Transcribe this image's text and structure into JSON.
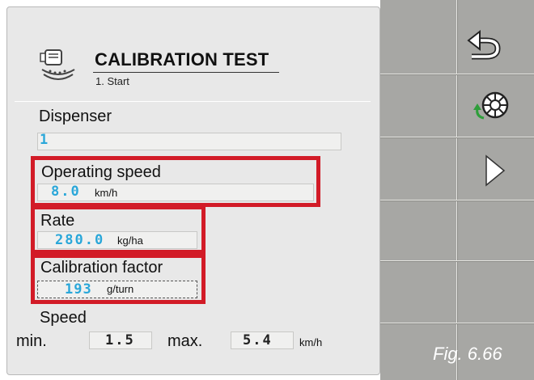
{
  "header": {
    "title": "CALIBRATION TEST",
    "subtitle": "1. Start"
  },
  "dispenser": {
    "label": "Dispenser",
    "value": "1"
  },
  "operating_speed": {
    "label": "Operating speed",
    "value": "8.0",
    "unit": "km/h"
  },
  "rate": {
    "label": "Rate",
    "value": "280.0",
    "unit": "kg/ha"
  },
  "calibration_factor": {
    "label": "Calibration factor",
    "value": "193",
    "unit": "g/turn"
  },
  "speed": {
    "label": "Speed",
    "min_label": "min.",
    "min_value": "1.5",
    "max_label": "max.",
    "max_value": "5.4",
    "unit": "km/h"
  },
  "softkeys": [
    {
      "icon": "back-arrow-icon"
    },
    {
      "icon": "calibration-dispenser-icon"
    },
    {
      "icon": "next-arrow-icon"
    }
  ],
  "figure_caption": "Fig. 6.66",
  "colors": {
    "value_blue": "#2aa7d9",
    "highlight_red": "#d21b27",
    "softkey_gray": "#a7a7a4"
  }
}
